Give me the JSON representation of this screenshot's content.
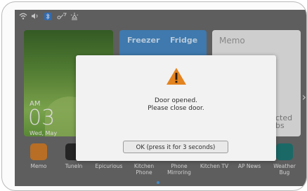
{
  "status_icons": [
    "wifi-icon",
    "volume-icon",
    "bluetooth-icon",
    "network-icon",
    "light-icon"
  ],
  "clock": {
    "ampm": "AM",
    "time": "03",
    "date": "Wed, May"
  },
  "fridge_widget": {
    "label_freezer": "Freezer",
    "label_fridge": "Fridge"
  },
  "memo_widget": {
    "title": "Memo",
    "line1": "cted",
    "line2": "bs"
  },
  "apps": [
    {
      "label": "Memo",
      "icon": "pencil-icon",
      "color": "#d9822b"
    },
    {
      "label": "TuneIn",
      "icon": "tunein-icon",
      "color": "#2b2b2b"
    },
    {
      "label": "Epicurious",
      "icon": "epi-icon",
      "color": "#d92525"
    },
    {
      "label": "Kitchen\nPhone",
      "icon": "phone-icon",
      "color": "#ffffff"
    },
    {
      "label": "Phone\nMirroring",
      "icon": "mirror-icon",
      "color": "#2a8fe0"
    },
    {
      "label": "Kitchen TV",
      "icon": "tv-icon",
      "color": "#3a5fb8"
    },
    {
      "label": "AP News",
      "icon": "ap-icon",
      "color": "#ffffff"
    },
    {
      "label": "Weather\nBug",
      "icon": "weatherbug-icon",
      "color": "#1f7c7a"
    }
  ],
  "dialog": {
    "line1": "Door opened.",
    "line2": "Please close door.",
    "button": "OK (press it for 3 seconds)",
    "warning_color": "#e3831f"
  }
}
